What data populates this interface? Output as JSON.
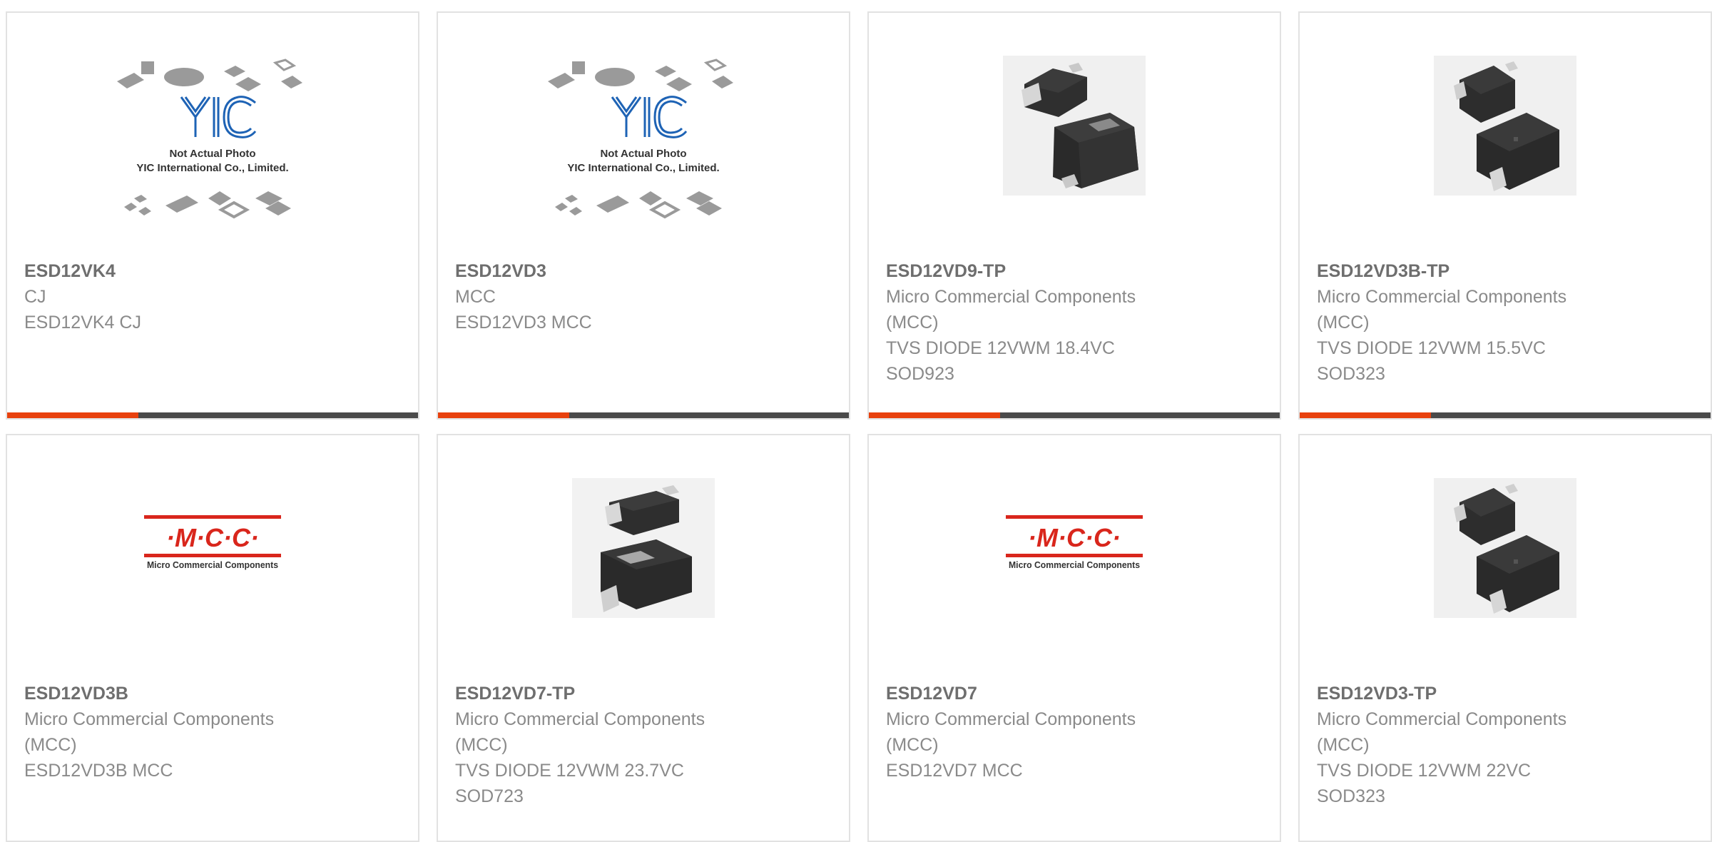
{
  "products": [
    {
      "part": "ESD12VK4",
      "lines": [
        "CJ",
        "ESD12VK4 CJ"
      ],
      "image": "yic-placeholder",
      "placeholder_text": [
        "Not Actual Photo",
        "YIC International Co., Limited."
      ],
      "progress": 0.32
    },
    {
      "part": "ESD12VD3",
      "lines": [
        "MCC",
        "ESD12VD3 MCC"
      ],
      "image": "yic-placeholder",
      "placeholder_text": [
        "Not Actual Photo",
        "YIC International Co., Limited."
      ],
      "progress": 0.32
    },
    {
      "part": "ESD12VD9-TP",
      "lines": [
        "Micro Commercial Components",
        "(MCC)",
        "TVS DIODE 12VWM 18.4VC",
        "SOD923"
      ],
      "image": "sod923-package",
      "progress": 0.32
    },
    {
      "part": "ESD12VD3B-TP",
      "lines": [
        "Micro Commercial Components",
        "(MCC)",
        "TVS DIODE 12VWM 15.5VC",
        "SOD323"
      ],
      "image": "sod323-package",
      "progress": 0.32
    },
    {
      "part": "ESD12VD3B",
      "lines": [
        "Micro Commercial Components",
        "(MCC)",
        "ESD12VD3B MCC"
      ],
      "image": "mcc-logo",
      "logo_text": [
        "·M·C·C·",
        "Micro Commercial Components"
      ]
    },
    {
      "part": "ESD12VD7-TP",
      "lines": [
        "Micro Commercial Components",
        "(MCC)",
        "TVS DIODE 12VWM 23.7VC",
        "SOD723"
      ],
      "image": "sod723-package"
    },
    {
      "part": "ESD12VD7",
      "lines": [
        "Micro Commercial Components",
        "(MCC)",
        "ESD12VD7 MCC"
      ],
      "image": "mcc-logo",
      "logo_text": [
        "·M·C·C·",
        "Micro Commercial Components"
      ]
    },
    {
      "part": "ESD12VD3-TP",
      "lines": [
        "Micro Commercial Components",
        "(MCC)",
        "TVS DIODE 12VWM 22VC",
        "SOD323"
      ],
      "image": "sod323-package"
    }
  ],
  "colors": {
    "accent": "#e8410e",
    "track": "#4a4a4a",
    "border": "#e2e2e2",
    "text": "#8a8a8a",
    "yic_blue": "#1e63b5",
    "mcc_red": "#d9261c"
  }
}
